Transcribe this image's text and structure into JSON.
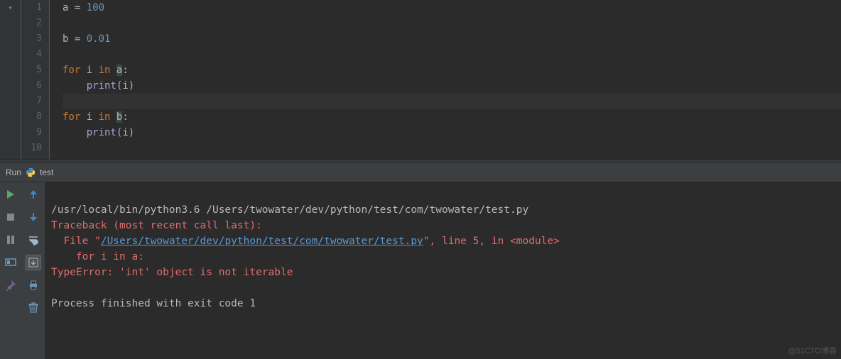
{
  "editor": {
    "lines": [
      {
        "n": "1",
        "tokens": [
          {
            "t": "a",
            "c": "var"
          },
          {
            "t": " ",
            "c": "op"
          },
          {
            "t": "=",
            "c": "op"
          },
          {
            "t": " ",
            "c": "op"
          },
          {
            "t": "100",
            "c": "num"
          }
        ]
      },
      {
        "n": "2",
        "tokens": []
      },
      {
        "n": "3",
        "tokens": [
          {
            "t": "b",
            "c": "var"
          },
          {
            "t": " ",
            "c": "op"
          },
          {
            "t": "=",
            "c": "op"
          },
          {
            "t": " ",
            "c": "op"
          },
          {
            "t": "0.01",
            "c": "num"
          }
        ]
      },
      {
        "n": "4",
        "tokens": []
      },
      {
        "n": "5",
        "tokens": [
          {
            "t": "for",
            "c": "kw"
          },
          {
            "t": " ",
            "c": "op"
          },
          {
            "t": "i",
            "c": "var"
          },
          {
            "t": " ",
            "c": "op"
          },
          {
            "t": "in",
            "c": "kw"
          },
          {
            "t": " ",
            "c": "op"
          },
          {
            "t": "a",
            "c": "var hl"
          },
          {
            "t": ":",
            "c": "op"
          }
        ]
      },
      {
        "n": "6",
        "tokens": [
          {
            "t": "    ",
            "c": "op"
          },
          {
            "t": "print",
            "c": "fn"
          },
          {
            "t": "(",
            "c": "paren"
          },
          {
            "t": "i",
            "c": "var"
          },
          {
            "t": ")",
            "c": "paren"
          }
        ]
      },
      {
        "n": "7",
        "tokens": [],
        "current": true
      },
      {
        "n": "8",
        "tokens": [
          {
            "t": "for",
            "c": "kw"
          },
          {
            "t": " ",
            "c": "op"
          },
          {
            "t": "i",
            "c": "var"
          },
          {
            "t": " ",
            "c": "op"
          },
          {
            "t": "in",
            "c": "kw"
          },
          {
            "t": " ",
            "c": "op"
          },
          {
            "t": "b",
            "c": "var hl"
          },
          {
            "t": ":",
            "c": "op"
          }
        ]
      },
      {
        "n": "9",
        "tokens": [
          {
            "t": "    ",
            "c": "op"
          },
          {
            "t": "print",
            "c": "fn"
          },
          {
            "t": "(",
            "c": "paren"
          },
          {
            "t": "i",
            "c": "var"
          },
          {
            "t": ")",
            "c": "paren"
          }
        ]
      },
      {
        "n": "10",
        "tokens": []
      }
    ]
  },
  "run_header": {
    "label": "Run",
    "config": "test"
  },
  "console": {
    "cmd": "/usr/local/bin/python3.6 /Users/twowater/dev/python/test/com/twowater/test.py",
    "trace_header": "Traceback (most recent call last):",
    "file_prefix": "  File \"",
    "file_link": "/Users/twowater/dev/python/test/com/twowater/test.py",
    "file_suffix": "\", line 5, in <module>",
    "code_context": "    for i in a:",
    "error": "TypeError: 'int' object is not iterable",
    "exit": "Process finished with exit code 1"
  },
  "watermark": "@51CTO博客"
}
